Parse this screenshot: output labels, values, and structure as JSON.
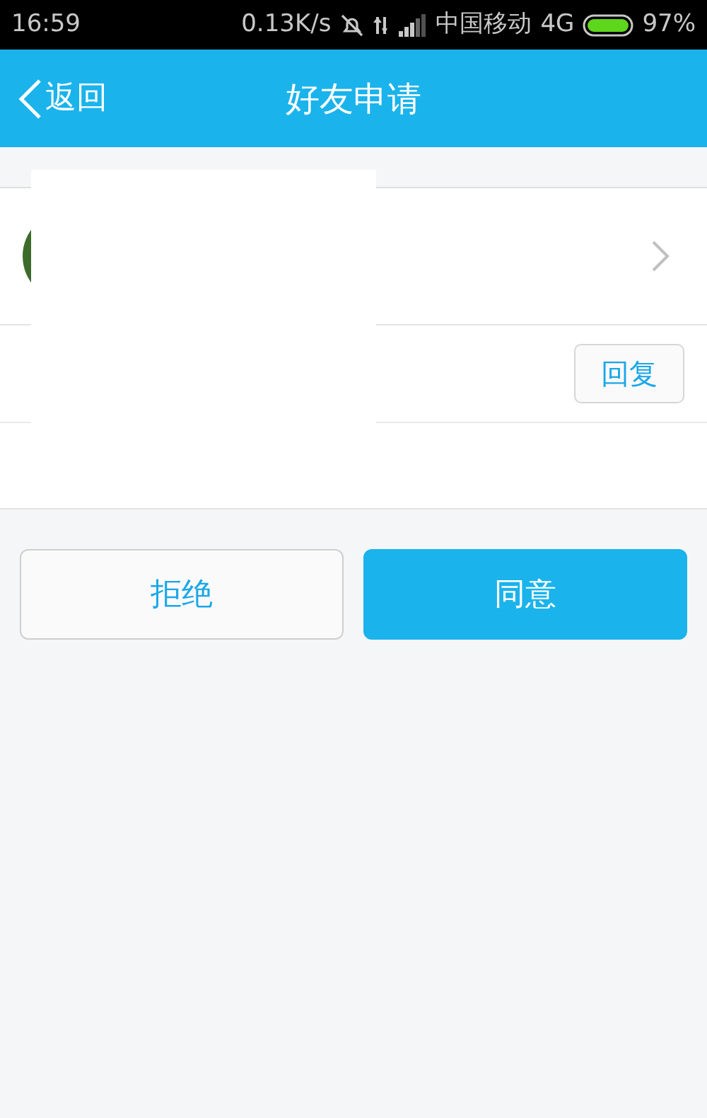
{
  "status_bar": {
    "time": "16:59",
    "speed": "0.13K/s",
    "carrier": "中国移动",
    "network": "4G",
    "battery": "97%"
  },
  "header": {
    "back": "返回",
    "title": "好友申请"
  },
  "reply_button": "回复",
  "buttons": [
    {
      "label": "拒绝",
      "kind": "secondary"
    },
    {
      "label": "同意",
      "kind": "primary"
    }
  ]
}
